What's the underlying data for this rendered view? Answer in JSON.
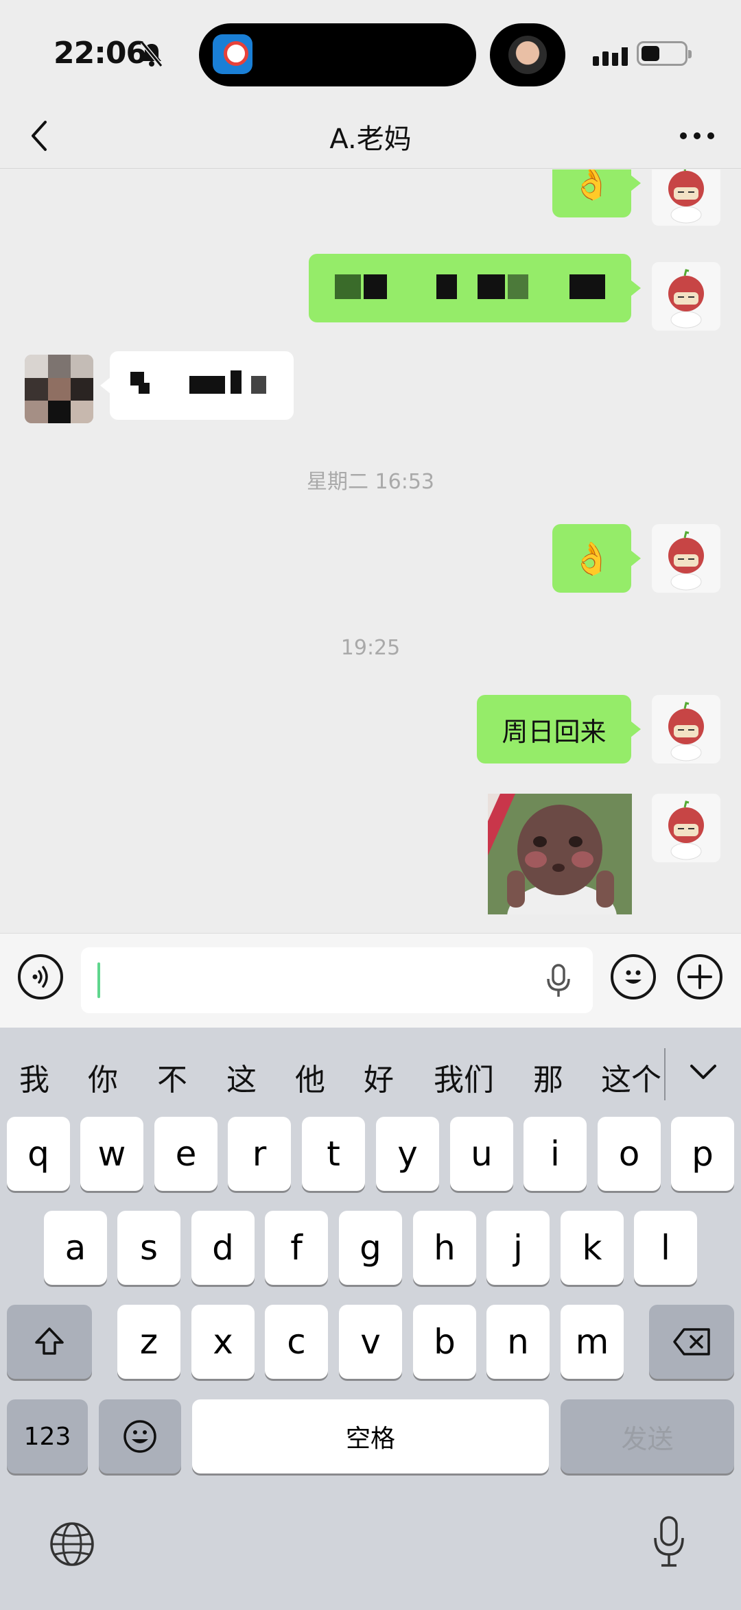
{
  "status_bar": {
    "time": "22:06",
    "icons": [
      "bell-slash-icon",
      "railway-app-icon",
      "contact-avatar-icon",
      "signal-icon",
      "battery-icon"
    ]
  },
  "header": {
    "title": "A.老妈",
    "back_icon": "chevron-left-icon",
    "more_icon": "more-dots-icon"
  },
  "messages": [
    {
      "type": "emoji",
      "side": "right",
      "emoji": "👌"
    },
    {
      "type": "text-redacted",
      "side": "right"
    },
    {
      "type": "text-redacted",
      "side": "left"
    },
    {
      "type": "timestamp",
      "text": "星期二 16:53"
    },
    {
      "type": "emoji",
      "side": "right",
      "emoji": "👌"
    },
    {
      "type": "timestamp",
      "text": "19:25"
    },
    {
      "type": "text",
      "side": "right",
      "text": "周日回来"
    },
    {
      "type": "sticker",
      "side": "right"
    }
  ],
  "input_bar": {
    "voice_icon": "voice-mode-icon",
    "mic_icon": "microphone-icon",
    "emoji_icon": "emoji-icon",
    "plus_icon": "plus-icon"
  },
  "keyboard": {
    "candidates": [
      "我",
      "你",
      "不",
      "这",
      "他",
      "好",
      "我们",
      "那",
      "这个"
    ],
    "row1": [
      "q",
      "w",
      "e",
      "r",
      "t",
      "y",
      "u",
      "i",
      "o",
      "p"
    ],
    "row2": [
      "a",
      "s",
      "d",
      "f",
      "g",
      "h",
      "j",
      "k",
      "l"
    ],
    "row3": [
      "z",
      "x",
      "c",
      "v",
      "b",
      "n",
      "m"
    ],
    "numbers_key": "123",
    "space_key": "空格",
    "send_key": "发送"
  },
  "colors": {
    "bubble_green": "#95ec69",
    "chat_bg": "#ededed",
    "keyboard_bg": "#d1d4da",
    "caret": "#5fd68d"
  }
}
